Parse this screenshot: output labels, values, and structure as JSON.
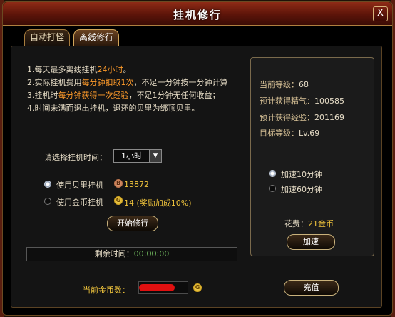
{
  "dialog": {
    "title": "挂机修行",
    "close_label": "X"
  },
  "tabs": [
    {
      "label": "自动打怪",
      "active": false
    },
    {
      "label": "离线修行",
      "active": true
    }
  ],
  "rules": [
    {
      "pre": "1.每天最多离线挂机",
      "hl": "24小时",
      "post": "。"
    },
    {
      "pre": "2.实际挂机费用",
      "hl": "每分钟扣取1次",
      "post": "，不足一分钟按一分钟计算"
    },
    {
      "pre": "3.挂机时",
      "hl": "每分钟获得一次经验",
      "post": "，不足1分钟无任何收益；"
    },
    {
      "pre": "4.时间未满而退出挂机，退还的贝里为绑顶贝里。",
      "hl": "",
      "post": ""
    }
  ],
  "time_select": {
    "label": "请选择挂机时间：",
    "value": "1小时"
  },
  "hang_options": [
    {
      "label": "使用贝里挂机",
      "checked": true,
      "coin_icon": "berry-coin-icon",
      "cost": "13872"
    },
    {
      "label": "使用金币挂机",
      "checked": false,
      "coin_icon": "gold-coin-icon",
      "cost": "14 (奖励加成10%)"
    }
  ],
  "start_button": "开始修行",
  "remaining": {
    "label": "剩余时间：",
    "value": "00:00:00"
  },
  "info": {
    "current_level": {
      "label": "当前等级：",
      "value": "68"
    },
    "expected_spirit": {
      "label": "预计获得精气：",
      "value": "100585"
    },
    "expected_exp": {
      "label": "预计获得经验：",
      "value": "201169"
    },
    "target_level": {
      "label": "目标等级：",
      "value": "Lv.69"
    }
  },
  "speed_options": [
    {
      "label": "加速10分钟",
      "checked": true
    },
    {
      "label": "加速60分钟",
      "checked": false
    }
  ],
  "cost": {
    "label": "花费：",
    "value": "21金币"
  },
  "speed_button": "加速",
  "gold_count": {
    "label": "当前金币数：",
    "value": ""
  },
  "recharge_button": "充值",
  "colors": {
    "highlight": "#ff9b2a",
    "gold": "#f0c43c",
    "remaining": "#7fd36b",
    "title_bar": "#8e2b16"
  }
}
